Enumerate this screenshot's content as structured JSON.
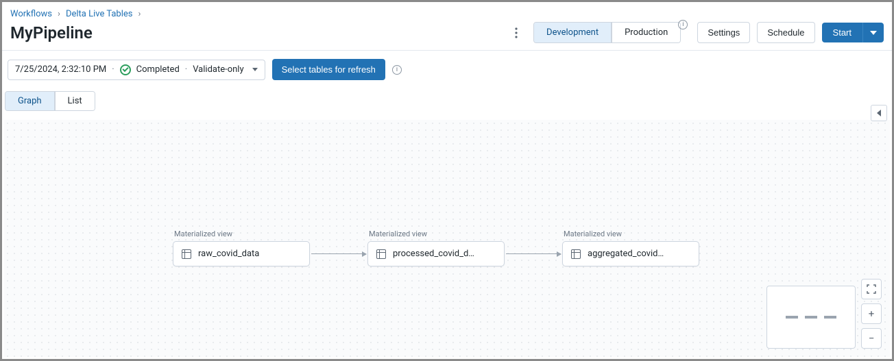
{
  "breadcrumbs": {
    "item0": "Workflows",
    "item1": "Delta Live Tables"
  },
  "page_title": "MyPipeline",
  "mode": {
    "development": "Development",
    "production": "Production"
  },
  "buttons": {
    "settings": "Settings",
    "schedule": "Schedule",
    "start": "Start",
    "refresh": "Select tables for refresh"
  },
  "run": {
    "timestamp": "7/25/2024, 2:32:10 PM",
    "status": "Completed",
    "type": "Validate-only"
  },
  "view": {
    "graph": "Graph",
    "list": "List"
  },
  "nodes": {
    "n0": {
      "type": "Materialized view",
      "name": "raw_covid_data"
    },
    "n1": {
      "type": "Materialized view",
      "name": "processed_covid_d…"
    },
    "n2": {
      "type": "Materialized view",
      "name": "aggregated_covid…"
    }
  },
  "icons": {
    "info": "i"
  }
}
